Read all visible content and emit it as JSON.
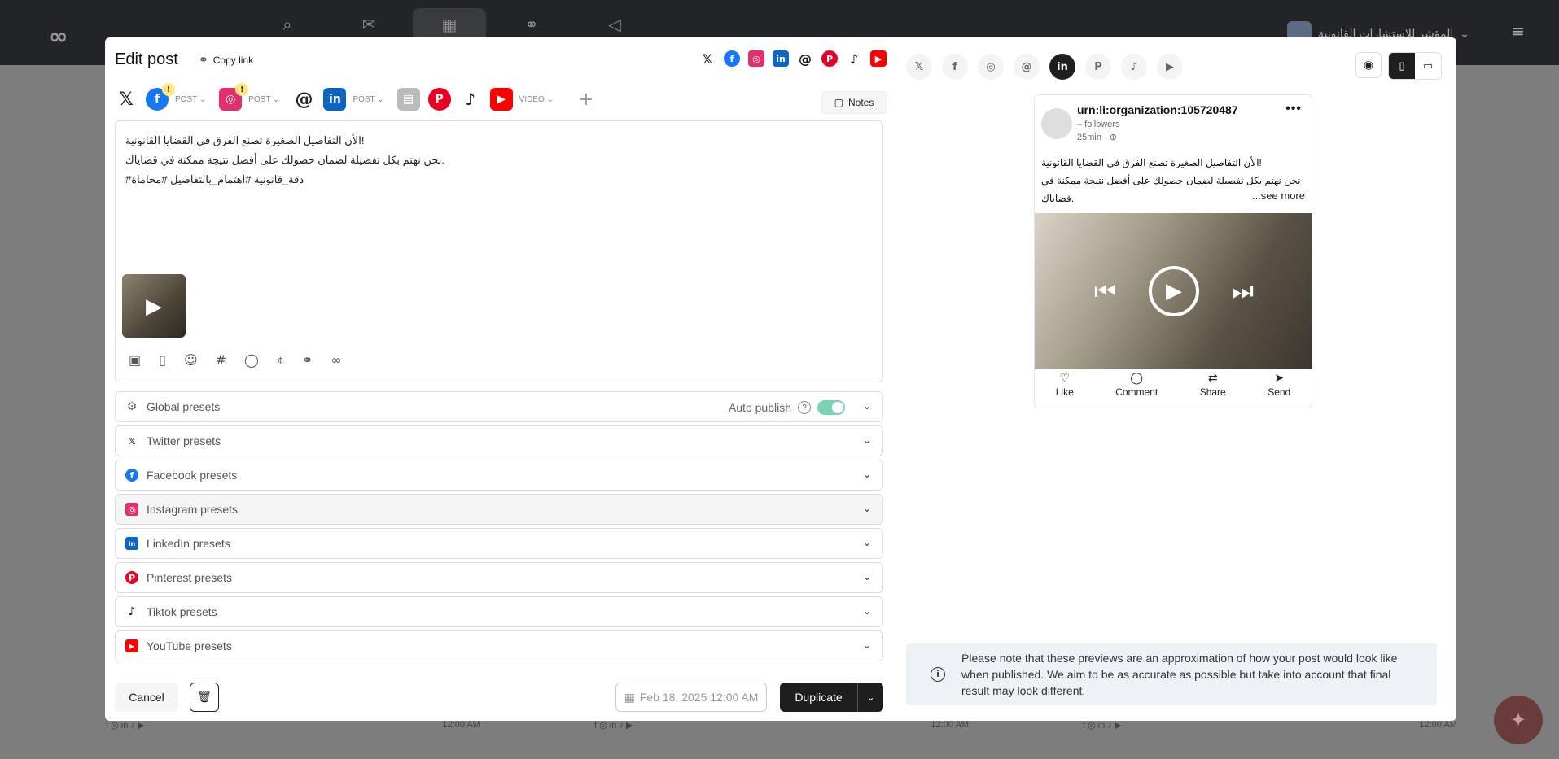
{
  "topbar": {
    "org_name": "المؤشر للاستشارات القانونية",
    "logo": "∞",
    "nav_icons": [
      "analytics-icon",
      "inbox-icon",
      "calendar-icon",
      "links-icon",
      "campaigns-icon"
    ]
  },
  "calendar_rows": {
    "time": "12:00 AM"
  },
  "modal": {
    "title": "Edit post",
    "copy_link": "Copy link",
    "notes": "Notes",
    "networks": {
      "facebook_type": "POST",
      "instagram_type": "POST",
      "linkedin_type": "POST",
      "youtube_type": "VIDEO",
      "badge": "!"
    },
    "editor_text": [
      "الأن التفاصيل الصغيرة تصنع الفرق في القضايا القانونية!",
      "نحن نهتم بكل تفصيلة لضمان حصولك على أفضل نتيجة ممكنة في قضاياك.",
      "#دقة_قانونية #اهتمام_بالتفاصيل #محاماة"
    ],
    "presets": {
      "global": "Global presets",
      "auto_publish": "Auto publish",
      "auto_publish_on": true,
      "twitter": "Twitter presets",
      "facebook": "Facebook presets",
      "instagram": "Instagram presets",
      "linkedin": "LinkedIn presets",
      "pinterest": "Pinterest presets",
      "tiktok": "Tiktok presets",
      "youtube": "YouTube presets"
    },
    "cancel": "Cancel",
    "date": "Feb 18, 2025 12:00 AM",
    "duplicate": "Duplicate"
  },
  "preview": {
    "active_network": "linkedin",
    "org_name": "urn:li:organization:105720487",
    "followers": "– followers",
    "time": "25min ·",
    "body": [
      "الأن التفاصيل الصغيرة تصنع الفرق في القضايا القانونية!",
      "نحن نهتم بكل تفصيلة لضمان حصولك على أفضل نتيجة ممكنة في",
      "قضاياك."
    ],
    "see_more": "...see more",
    "actions": {
      "like": "Like",
      "comment": "Comment",
      "share": "Share",
      "send": "Send"
    },
    "note": "Please note that these previews are an approximation of how your post would look like when published. We aim to be as accurate as possible but take into account that final result may look different."
  },
  "colors": {
    "facebook": "#1877f2",
    "instagram": "#e1306c",
    "linkedin": "#0a66c2",
    "pinterest": "#e60023",
    "youtube": "#ff0000",
    "toggle": "#7bd3b6",
    "primary_dark": "#1e1e1e"
  }
}
